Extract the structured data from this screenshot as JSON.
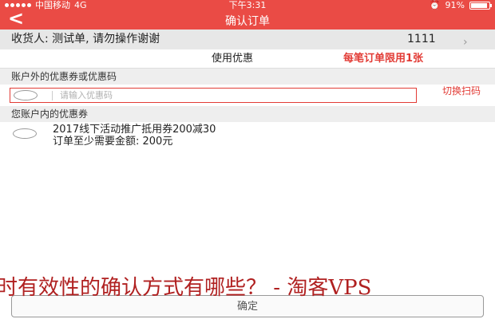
{
  "status_bar": {
    "carrier": "中国移动",
    "network": "4G",
    "time": "下午3:31",
    "battery": "91%",
    "battery_level": 0.91
  },
  "nav": {
    "back_icon": "chevron-left-icon",
    "title": "确认订单"
  },
  "receiver": {
    "info": "收货人:  测试单,  请勿操作谢谢",
    "phone": "1111",
    "arrow_icon": "chevron-right-icon"
  },
  "coupon_panel": {
    "use_label": "使用优惠",
    "limit_note": "每笔订单限用1张",
    "external_section_title": "账户外的优惠券或优惠码",
    "code_placeholder": "请输入优惠码",
    "switch_scan_label": "切换扫码",
    "internal_section_title": "您账户内的优惠券",
    "coupons": [
      {
        "name": "2017线下活动推广抵用券200减30",
        "min_amount": "订单至少需要金额:  200元"
      }
    ]
  },
  "footer": {
    "confirm_label": "确定"
  },
  "overlay_caption": "时有效性的确认方式有哪些？ - 淘客VPS",
  "colors": {
    "brand_red": "#ea4b45",
    "accent_red": "#e23b35",
    "section_bg": "#eeeeee"
  }
}
